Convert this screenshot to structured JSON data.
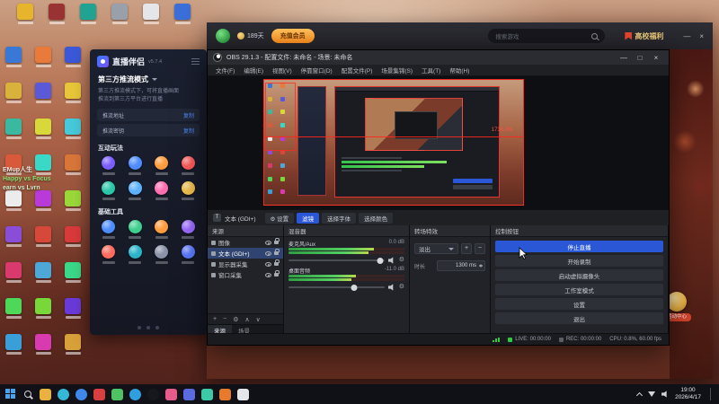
{
  "desktop": {
    "top_icons": [
      {
        "color": "#e7b52c"
      },
      {
        "color": "#993333"
      },
      {
        "color": "#20a390"
      },
      {
        "color": "#9aa0aa"
      },
      {
        "color": "#e4e6ea"
      },
      {
        "color": "#3a6fd8"
      }
    ],
    "left_icon_colors": [
      "#3a78d8",
      "#d8b23a",
      "#3ab8a0",
      "#d85a3a",
      "#ececec",
      "#8a4dd8",
      "#d83a6e",
      "#4dd85a",
      "#3a9ed8",
      "#e87a3a",
      "#5a5ad8",
      "#d8d83a",
      "#3ad8c6",
      "#b83ad8",
      "#d8483a",
      "#4da8d8",
      "#78d83a",
      "#d83ab0",
      "#3a58d8",
      "#e8c63a",
      "#46c9d8",
      "#d8763a",
      "#9ad83a",
      "#d83a3a",
      "#3ad888",
      "#6a3ad8",
      "#d8a03a"
    ],
    "overlay_lines": [
      {
        "text": "EMup人生",
        "color": "#efe9df"
      },
      {
        "text": "Happy vs Focus",
        "color": "#86e06d"
      },
      {
        "text": "earn vs Lvrn",
        "color": "#cfe9c9"
      }
    ]
  },
  "launcher": {
    "member_days": "189天",
    "recharge_label": "充值会员",
    "search_placeholder": "搜索游戏",
    "welfare_label": "高校福利",
    "badge_label": "活动中心",
    "window_buttons": [
      "—",
      "×"
    ]
  },
  "companion": {
    "title": "直播伴侣",
    "version": "v5.7.4",
    "mode_label": "第三方推流模式",
    "desc_lines": [
      "第三方推流模式下，可将直播画面",
      "推流到第三方平台进行直播"
    ],
    "fields": [
      {
        "label": "推流地址",
        "action": "复制"
      },
      {
        "label": "推流密钥",
        "action": "复制"
      }
    ],
    "sections": [
      {
        "title": "互动玩法",
        "colors": [
          "#7a5cff",
          "#4d8dff",
          "#ff9c3d",
          "#ff5c5c",
          "#2bc6a8",
          "#5cb2ff",
          "#ff6fb0",
          "#f2c14d"
        ]
      },
      {
        "title": "基础工具",
        "colors": [
          "#4d8dff",
          "#3ecf8e",
          "#ff9c3d",
          "#9c6cff",
          "#ff6b5c",
          "#2bb3c9",
          "#8a93a8",
          "#5c79ff"
        ]
      }
    ]
  },
  "obs": {
    "title": "OBS 29.1.3 - 配置文件: 未命名 - 场景: 未命名",
    "window_buttons": [
      "—",
      "□",
      "×"
    ],
    "menu": [
      "文件(F)",
      "编辑(E)",
      "视图(V)",
      "停靠窗口(D)",
      "配置文件(P)",
      "场景集锦(S)",
      "工具(T)",
      "帮助(H)"
    ],
    "preview": {
      "zoom_label": "1736.0%"
    },
    "quickrow": {
      "source_icon": "T",
      "source_label": "文本 (GDI+)",
      "buttons": [
        {
          "label": "设置",
          "icon": "⚙",
          "name": "source-settings-button"
        },
        {
          "label": "滤镜",
          "primary": true,
          "name": "filters-button"
        },
        {
          "label": "选择字体",
          "name": "select-font-button"
        },
        {
          "label": "选择颜色",
          "name": "select-color-button"
        }
      ]
    },
    "sources": {
      "header": "来源",
      "items": [
        {
          "name": "图像"
        },
        {
          "name": "文本 (GDI+)",
          "selected": true
        },
        {
          "name": "显示器采集"
        },
        {
          "name": "窗口采集"
        }
      ],
      "toolbar": [
        {
          "glyph": "+",
          "name": "add-source-button"
        },
        {
          "glyph": "−",
          "name": "remove-source-button"
        },
        {
          "glyph": "⚙",
          "name": "source-properties-button"
        },
        {
          "glyph": "∧",
          "name": "move-source-up-button"
        },
        {
          "glyph": "∨",
          "name": "move-source-down-button"
        }
      ],
      "tabs": [
        "来源",
        "场景"
      ]
    },
    "mixer": {
      "header": "混音器",
      "channels": [
        {
          "name": "麦克风/Aux",
          "db": "0.0 dB",
          "meter": 0.74,
          "slider": 0.96
        },
        {
          "name": "桌面音频",
          "db": "-11.0 dB",
          "meter": 0.58,
          "slider": 0.68
        }
      ]
    },
    "transitions": {
      "header": "转场特效",
      "selected": "淡出",
      "buttons": [
        "+",
        "−"
      ],
      "duration_label": "时长",
      "duration_value": "1300 ms"
    },
    "controls": {
      "header": "控制按钮",
      "buttons": [
        {
          "label": "停止直播",
          "name": "stop-streaming-button",
          "primary": true
        },
        {
          "label": "开始录制",
          "name": "start-recording-button"
        },
        {
          "label": "启动虚拟摄像头",
          "name": "start-virtual-camera-button"
        },
        {
          "label": "工作室模式",
          "name": "studio-mode-button"
        },
        {
          "label": "设置",
          "name": "settings-button"
        },
        {
          "label": "退出",
          "name": "exit-button"
        }
      ]
    },
    "statusbar": {
      "live": "LIVE: 00:00:00",
      "rec": "REC: 00:00:00",
      "cpu": "CPU: 0.8%, 60.00 fps"
    }
  },
  "taskbar": {
    "time": "19:00",
    "date": "2026/4/17",
    "apps": [
      {
        "name": "start-button",
        "type": "win"
      },
      {
        "name": "taskbar-search-icon",
        "type": "search"
      },
      {
        "name": "app-explorer",
        "color": "#e8b23d"
      },
      {
        "name": "app-edge",
        "color": "#35b8d8",
        "shape": "circle"
      },
      {
        "name": "app-browser",
        "color": "#3f87e8",
        "shape": "circle"
      },
      {
        "name": "app-red",
        "color": "#d84040"
      },
      {
        "name": "app-wechat",
        "color": "#4fc264"
      },
      {
        "name": "app-qq",
        "color": "#2f9fe0",
        "shape": "circle"
      },
      {
        "name": "app-obs",
        "color": "#17181d",
        "shape": "circle"
      },
      {
        "name": "app-pink",
        "color": "#e85a8a"
      },
      {
        "name": "app-purple",
        "color": "#5a6ae0"
      },
      {
        "name": "app-teal",
        "color": "#3dc9a8"
      },
      {
        "name": "app-orange",
        "color": "#e87a2e"
      },
      {
        "name": "app-light",
        "color": "#e4e6ea"
      }
    ]
  }
}
